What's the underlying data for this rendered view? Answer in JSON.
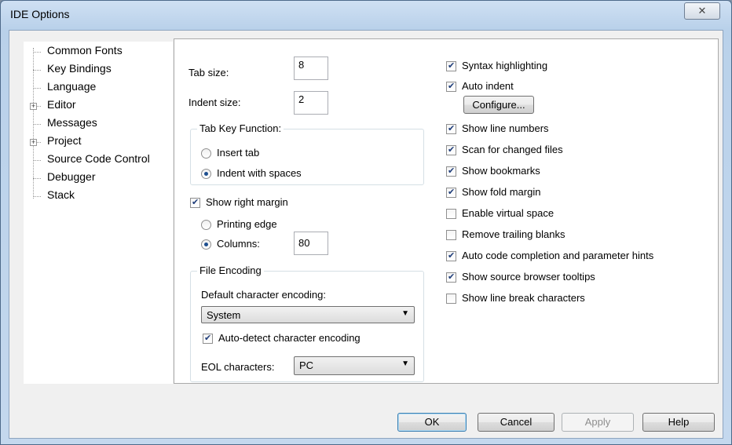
{
  "window": {
    "title": "IDE Options",
    "close_glyph": "✕"
  },
  "tree": {
    "items": [
      {
        "label": "Common Fonts",
        "expandable": false
      },
      {
        "label": "Key Bindings",
        "expandable": false
      },
      {
        "label": "Language",
        "expandable": false
      },
      {
        "label": "Editor",
        "expandable": true
      },
      {
        "label": "Messages",
        "expandable": false
      },
      {
        "label": "Project",
        "expandable": true
      },
      {
        "label": "Source Code Control",
        "expandable": false
      },
      {
        "label": "Debugger",
        "expandable": false
      },
      {
        "label": "Stack",
        "expandable": false
      }
    ],
    "expander_glyph": "+"
  },
  "editor": {
    "tab_size_label": "Tab size:",
    "tab_size_value": "8",
    "indent_size_label": "Indent size:",
    "indent_size_value": "2",
    "tab_key_group": {
      "title": "Tab Key Function:",
      "insert_tab": "Insert tab",
      "indent_with_spaces": "Indent with spaces",
      "selected": "indent_with_spaces"
    },
    "show_right_margin": {
      "label": "Show right margin",
      "checked": true
    },
    "printing_edge": "Printing edge",
    "columns_label": "Columns:",
    "columns_value": "80",
    "margin_selected": "columns",
    "file_encoding": {
      "title": "File Encoding",
      "default_label": "Default character encoding:",
      "default_value": "System",
      "auto_detect": {
        "label": "Auto-detect character encoding",
        "checked": true
      },
      "eol_label": "EOL characters:",
      "eol_value": "PC"
    },
    "options": [
      {
        "label": "Syntax highlighting",
        "checked": true
      },
      {
        "label": "Auto indent",
        "checked": true
      },
      {
        "label": "Show line numbers",
        "checked": true
      },
      {
        "label": "Scan for changed files",
        "checked": true
      },
      {
        "label": "Show bookmarks",
        "checked": true
      },
      {
        "label": "Show fold margin",
        "checked": true
      },
      {
        "label": "Enable virtual space",
        "checked": false
      },
      {
        "label": "Remove trailing blanks",
        "checked": false
      },
      {
        "label": "Auto code completion and parameter hints",
        "checked": true
      },
      {
        "label": "Show source browser tooltips",
        "checked": true
      },
      {
        "label": "Show line break characters",
        "checked": false
      }
    ],
    "configure_button": "Configure..."
  },
  "buttons": {
    "ok": "OK",
    "cancel": "Cancel",
    "apply": "Apply",
    "help": "Help"
  },
  "icons": {
    "dropdown": "▼"
  }
}
